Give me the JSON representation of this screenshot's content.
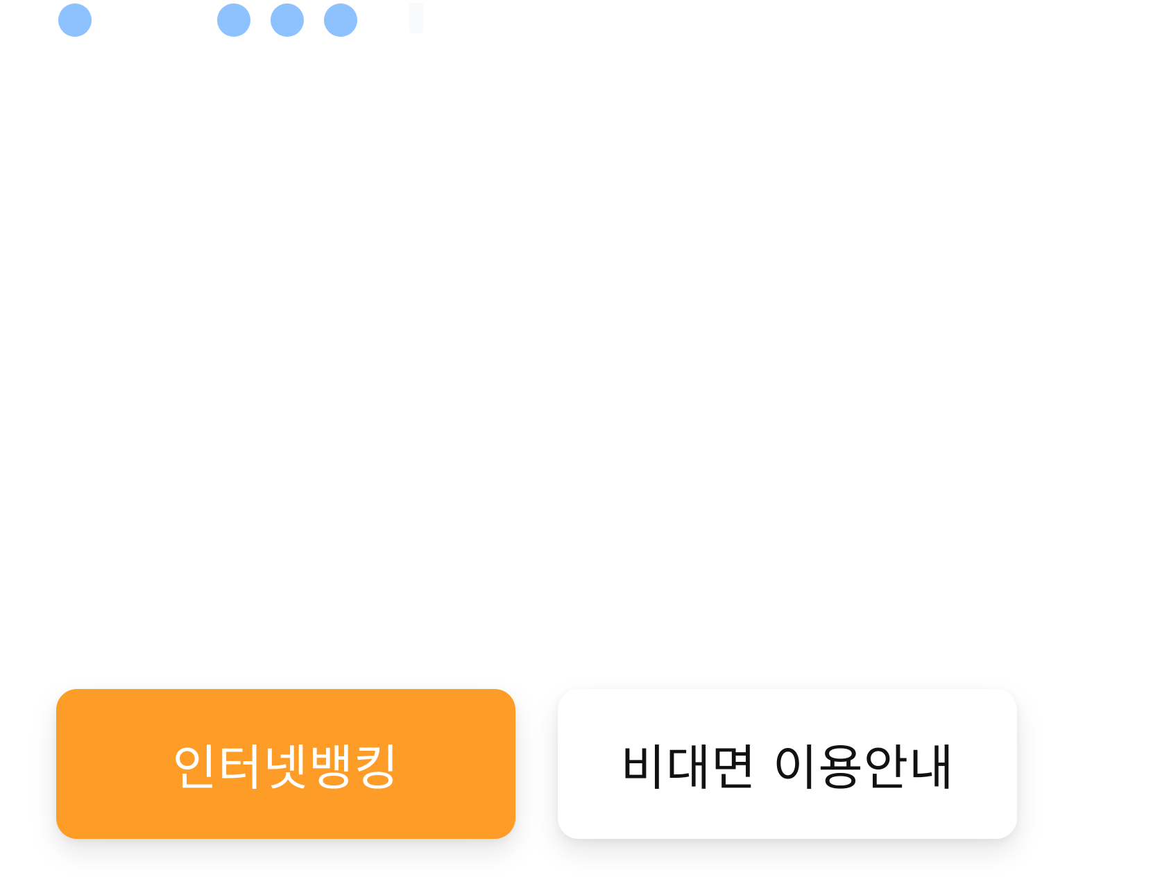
{
  "colors": {
    "indicator_dot": "#8EC2FF",
    "primary_button_bg": "#FD9C26",
    "secondary_button_bg": "#FFFFFF"
  },
  "indicators": [
    {
      "icon": "dot-icon"
    },
    {
      "icon": "dot-icon"
    },
    {
      "icon": "dot-icon"
    },
    {
      "icon": "dot-icon"
    }
  ],
  "actions": {
    "primary_label": "인터넷뱅킹",
    "secondary_label": "비대면 이용안내"
  }
}
